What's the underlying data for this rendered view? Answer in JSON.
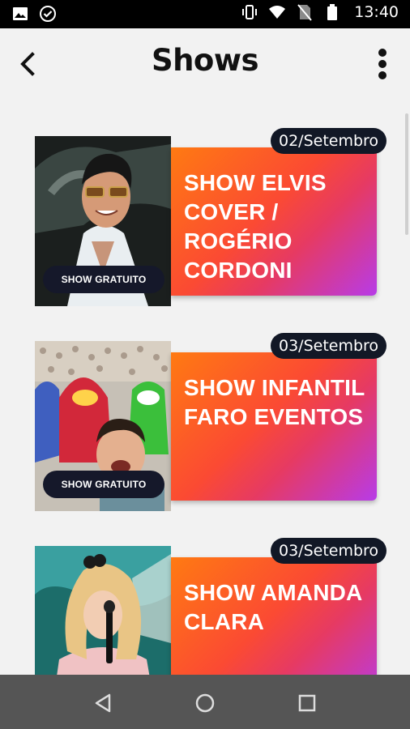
{
  "status_bar": {
    "time": "13:40",
    "icons": [
      "image-icon",
      "check-circle-icon",
      "vibrate-icon",
      "wifi-icon",
      "no-sim-icon",
      "battery-icon"
    ]
  },
  "app_bar": {
    "title": "Shows",
    "back_icon": "arrow-back-icon",
    "menu_icon": "more-vertical-icon"
  },
  "shows": [
    {
      "date": "02/Setembro",
      "title": "SHOW ELVIS COVER / ROGÉRIO CORDONI",
      "badge": "SHOW GRATUITO"
    },
    {
      "date": "03/Setembro",
      "title": "SHOW INFANTIL FARO EVENTOS",
      "badge": "SHOW GRATUITO"
    },
    {
      "date": "03/Setembro",
      "title": "SHOW AMANDA CLARA",
      "badge": ""
    }
  ],
  "colors": {
    "panel_gradient_start": "#ff7a12",
    "panel_gradient_end": "#b73be8",
    "pill_bg": "#121826",
    "nav_bar": "#555555"
  }
}
